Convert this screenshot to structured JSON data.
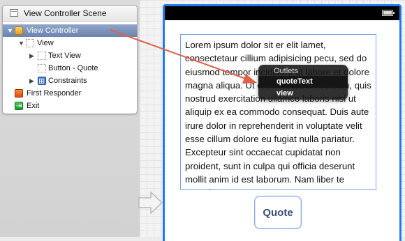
{
  "outline": {
    "scene_title": "View Controller Scene",
    "items": [
      {
        "label": "View Controller",
        "icon": "view-controller-icon",
        "selected": true
      },
      {
        "label": "View",
        "icon": "view-icon"
      },
      {
        "label": "Text View",
        "icon": "text-view-icon"
      },
      {
        "label": "Button - Quote",
        "icon": "button-icon"
      },
      {
        "label": "Constraints",
        "icon": "constraints-icon"
      },
      {
        "label": "First Responder",
        "icon": "first-responder-icon"
      },
      {
        "label": "Exit",
        "icon": "exit-icon"
      }
    ]
  },
  "canvas": {
    "text_view": {
      "text": "Lorem ipsum dolor sit er elit lamet, consectetaur cillium adipisicing pecu, sed do eiusmod tempor incididunt ut labore et dolore magna aliqua. Ut enim ad minim veniam, quis nostrud exercitation ullamco laboris nisi ut aliquip ex ea commodo consequat. Duis aute irure dolor in reprehenderit in voluptate velit esse cillum dolore eu fugiat nulla pariatur. Excepteur sint occaecat cupidatat non proident, sunt in culpa qui officia deserunt mollit anim id est laborum. Nam liber te conscient to"
    },
    "button_label": "Quote"
  },
  "outlets_popup": {
    "title": "Outlets",
    "items": [
      "quoteText",
      "view"
    ],
    "highlighted": "quoteText"
  },
  "colors": {
    "selection": "#7891ba",
    "phone_border": "#1e7cf0",
    "drag_line": "#e0604a"
  }
}
